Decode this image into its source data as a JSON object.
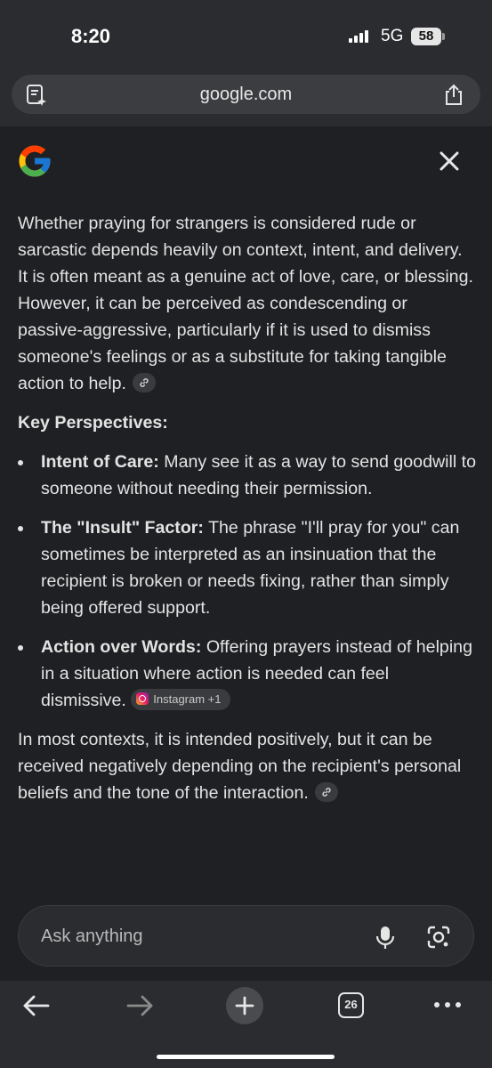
{
  "status_bar": {
    "time": "8:20",
    "network": "5G",
    "battery": "58"
  },
  "browser": {
    "url": "google.com"
  },
  "answer": {
    "intro": "Whether praying for strangers is considered rude or sarcastic depends heavily on context, intent, and delivery. It is often meant as a genuine act of love, care, or blessing. However, it can be perceived as condescending or passive-aggressive, particularly if it is used to dismiss someone's feelings or as a substitute for taking tangible action to help.",
    "heading": "Key Perspectives:",
    "bullets": [
      {
        "title": "Intent of Care:",
        "text": "Many see it as a way to send goodwill to someone without needing their permission."
      },
      {
        "title": "The \"Insult\" Factor:",
        "text": "The phrase \"I'll pray for you\" can sometimes be interpreted as an insinuation that the recipient is broken or needs fixing, rather than simply being offered support."
      },
      {
        "title": "Action over Words:",
        "text": "Offering prayers instead of helping in a situation where action is needed can feel dismissive."
      }
    ],
    "source_chip": "Instagram +1",
    "conclusion": "In most contexts, it is intended positively, but it can be received negatively depending on the recipient's personal beliefs and the tone of the interaction."
  },
  "ask": {
    "placeholder": "Ask anything"
  },
  "toolbar": {
    "tab_count": "26"
  }
}
